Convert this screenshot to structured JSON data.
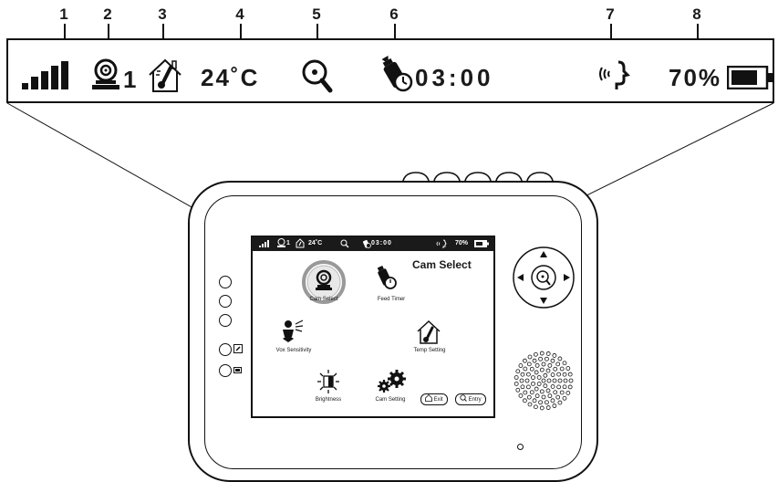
{
  "callouts": [
    "1",
    "2",
    "3",
    "4",
    "5",
    "6",
    "7",
    "8"
  ],
  "status_bar": {
    "camera_number": "1",
    "temperature": "24˚C",
    "feed_timer": "03:00",
    "battery": "70%"
  },
  "mini_status": {
    "camera_number": "1",
    "temperature": "24˚C",
    "feed_timer": "03:00",
    "battery": "70%"
  },
  "screen": {
    "title": "Cam Select",
    "menu": {
      "cam_select": "Cam Select",
      "feed_timer": "Feed Timer",
      "vox_sensitivity": "Vox Sensitivity",
      "temp_setting": "Temp Setting",
      "brightness": "Brightness",
      "cam_setting": "Cam Setting"
    },
    "exit_label": "Exit",
    "entry_label": "Entry"
  },
  "icons": [
    "signal-icon",
    "camera-icon",
    "thermometer-house-icon",
    "zoom-icon",
    "bottle-timer-icon",
    "vox-icon",
    "battery-icon",
    "brightness-icon",
    "gear-icon",
    "nav-pad-icon",
    "speaker-icon"
  ]
}
